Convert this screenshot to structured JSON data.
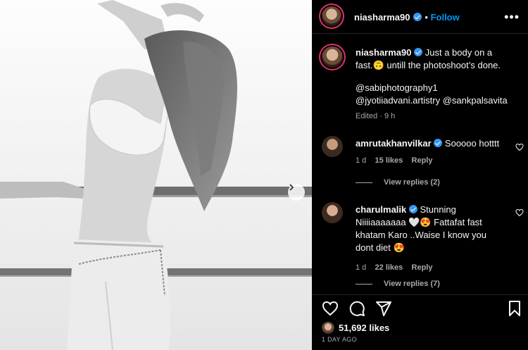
{
  "post": {
    "username": "niasharma90",
    "follow_label": "Follow",
    "more_label": "•••"
  },
  "caption": {
    "username": "niasharma90",
    "line1": "Just a body on a",
    "line2": "fast.🙃 untill the photoshoot’s done.",
    "mention1": "@sabiphotography1",
    "mention2": "@jyotiiadvani.artistry @sankpalsavita",
    "edited": "Edited · 9 h"
  },
  "comments": [
    {
      "username": "amrutakhanvilkar",
      "text": "Sooooo hotttt",
      "time": "1 d",
      "likes": "15 likes",
      "reply_label": "Reply",
      "view_replies": "View replies (2)"
    },
    {
      "username": "charulmalik",
      "line1": "Stunning",
      "line2": "Niiiiaaaaaaa 🤍😍 Fattafat fast",
      "line3": "khatam Karo ..Waise I know you",
      "line4": "dont diet 😍",
      "time": "1 d",
      "likes": "22 likes",
      "reply_label": "Reply",
      "view_replies": "View replies (7)"
    }
  ],
  "footer": {
    "likes": "51,692 likes",
    "time_ago": "1 DAY AGO"
  },
  "colors": {
    "verified": "#3897f0",
    "follow": "#0095f6",
    "story_ring": "#e1306c",
    "muted": "#a8a8a8"
  },
  "icons": [
    "next-arrow-icon",
    "verified-icon",
    "more-icon",
    "heart-icon",
    "comment-icon",
    "share-icon",
    "bookmark-icon"
  ]
}
